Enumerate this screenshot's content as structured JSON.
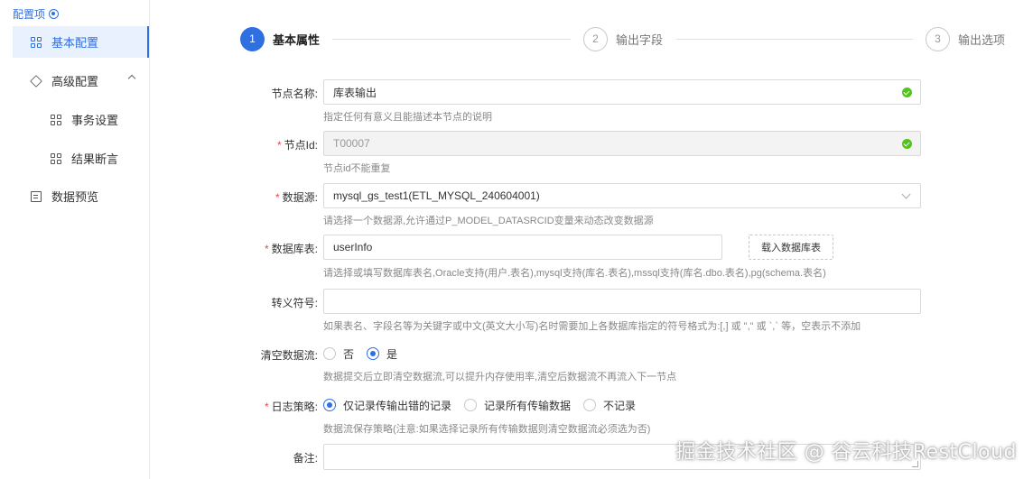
{
  "sidebar": {
    "header": "配置项",
    "items": [
      {
        "label": "基本配置"
      },
      {
        "label": "高级配置"
      },
      {
        "label": "事务设置"
      },
      {
        "label": "结果断言"
      },
      {
        "label": "数据预览"
      }
    ]
  },
  "steps": [
    {
      "num": "1",
      "label": "基本属性"
    },
    {
      "num": "2",
      "label": "输出字段"
    },
    {
      "num": "3",
      "label": "输出选项"
    }
  ],
  "form": {
    "node_name": {
      "label": "节点名称:",
      "value": "库表输出",
      "hint": "指定任何有意义且能描述本节点的说明"
    },
    "node_id": {
      "label": "节点Id:",
      "value": "T00007",
      "hint": "节点id不能重复"
    },
    "datasource": {
      "label": "数据源:",
      "value": "mysql_gs_test1(ETL_MYSQL_240604001)",
      "hint": "请选择一个数据源,允许通过P_MODEL_DATASRCID变量来动态改变数据源"
    },
    "table": {
      "label": "数据库表:",
      "value": "userInfo",
      "button": "载入数据库表",
      "hint": "请选择或填写数据库表名,Oracle支持(用户.表名),mysql支持(库名.表名),mssql支持(库名.dbo.表名),pg(schema.表名)"
    },
    "escape": {
      "label": "转义符号:",
      "value": "",
      "hint": "如果表名、字段名等为关键字或中文(英文大小写)名时需要加上各数据库指定的符号格式为:[,] 或 \",\" 或 `,` 等，空表示不添加"
    },
    "clear_stream": {
      "label": "清空数据流:",
      "options": [
        "否",
        "是"
      ],
      "selected": "是",
      "hint": "数据提交后立即清空数据流,可以提升内存使用率,清空后数据流不再流入下一节点"
    },
    "log_policy": {
      "label": "日志策略:",
      "options": [
        "仅记录传输出错的记录",
        "记录所有传输数据",
        "不记录"
      ],
      "selected": "仅记录传输出错的记录",
      "hint": "数据流保存策略(注意:如果选择记录所有传输数据则清空数据流必须选为否)"
    },
    "remark": {
      "label": "备注:",
      "value": ""
    }
  },
  "watermark": "掘金技术社区 @ 谷云科技RestCloud",
  "colors": {
    "accent": "#2f6fe0",
    "required": "#e5484d",
    "success": "#52c41a"
  }
}
